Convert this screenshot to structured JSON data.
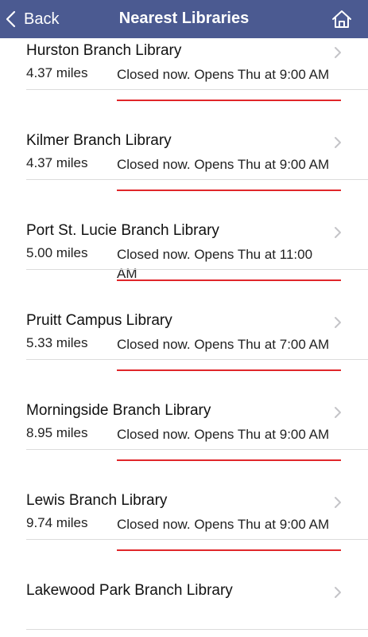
{
  "theme": {
    "nav_bg": "#4b5a91",
    "underline_color": "#e0262a"
  },
  "navbar": {
    "back_label": "Back",
    "back_icon": "chevron-left-icon",
    "title": "Nearest Libraries",
    "home_icon": "home-icon"
  },
  "libraries": [
    {
      "name": "Hurston Branch Library",
      "distance": "4.37 miles",
      "status": "Closed now. Opens Thu at 9:00 AM"
    },
    {
      "name": "Kilmer Branch Library",
      "distance": "4.37 miles",
      "status": "Closed now. Opens Thu at 9:00 AM"
    },
    {
      "name": "Port St. Lucie Branch Library",
      "distance": "5.00 miles",
      "status": "Closed now. Opens Thu at 11:00 AM"
    },
    {
      "name": "Pruitt Campus Library",
      "distance": "5.33 miles",
      "status": "Closed now. Opens Thu at 7:00 AM"
    },
    {
      "name": "Morningside Branch Library",
      "distance": "8.95 miles",
      "status": "Closed now. Opens Thu at 9:00 AM"
    },
    {
      "name": "Lewis Branch Library",
      "distance": "9.74 miles",
      "status": "Closed now. Opens Thu at 9:00 AM"
    },
    {
      "name": "Lakewood Park Branch Library",
      "distance": "",
      "status": ""
    }
  ]
}
